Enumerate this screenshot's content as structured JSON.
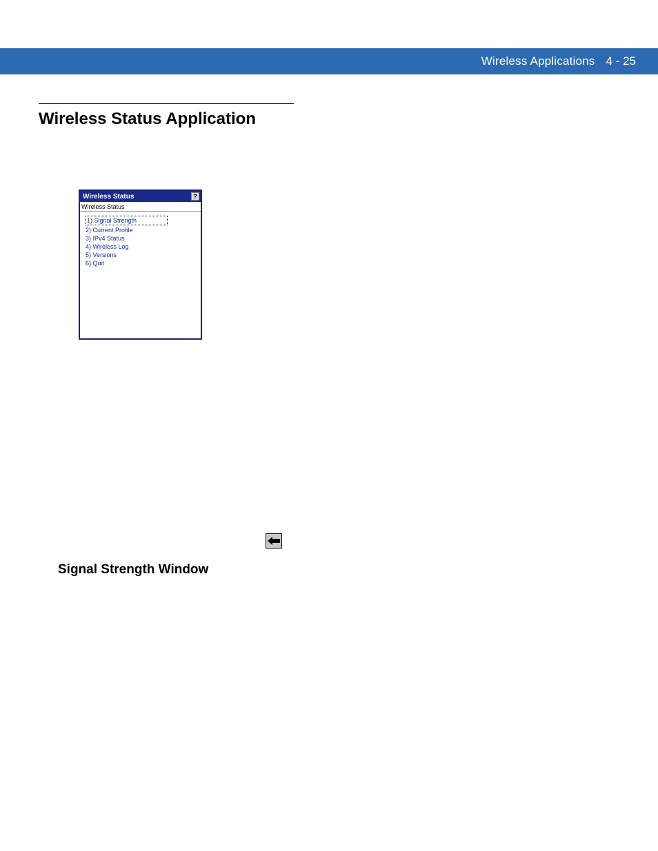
{
  "header": {
    "chapter_title": "Wireless Applications",
    "page_number": "4 - 25"
  },
  "section": {
    "title": "Wireless Status Application"
  },
  "screenshot": {
    "window_title": "Wireless Status",
    "help_button": "?",
    "sub_header": "Wireless Status",
    "items": [
      "1) Signal Strength",
      "2) Current Profile",
      "3) IPv4 Status",
      "4) Wireless Log",
      "5) Versions",
      "6) Quit"
    ]
  },
  "subsection": {
    "title": "Signal Strength Window"
  }
}
